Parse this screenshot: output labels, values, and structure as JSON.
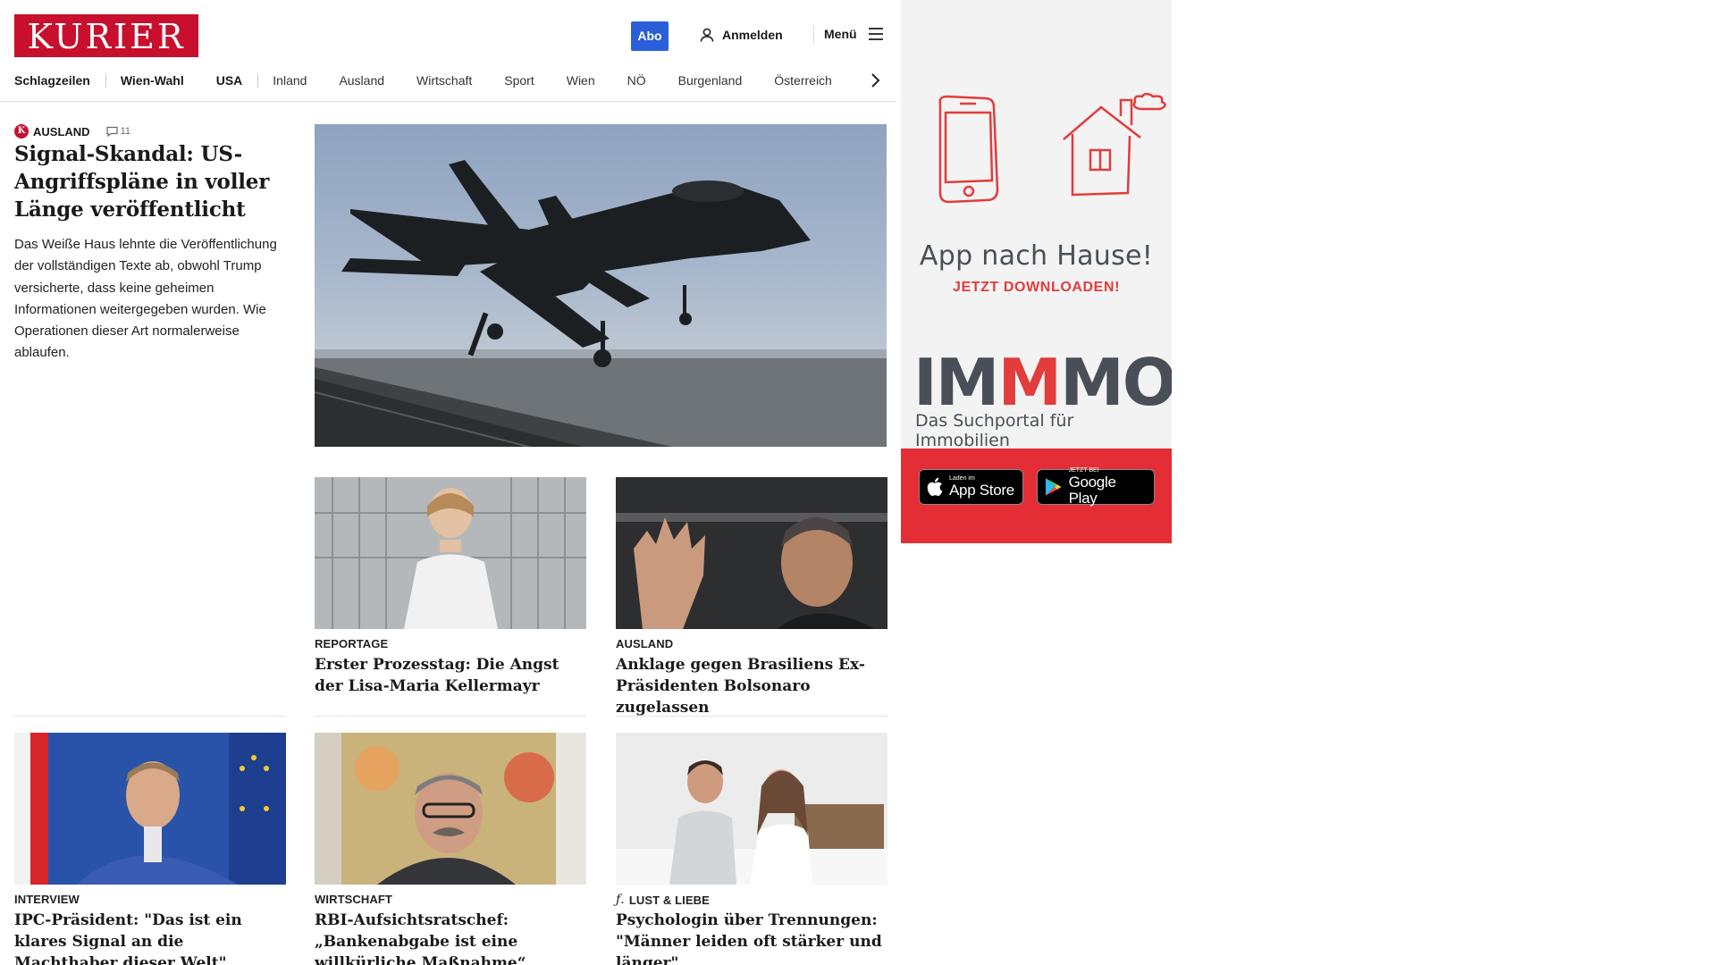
{
  "header": {
    "logo": "KURIER",
    "abo_label": "Abo",
    "login_label": "Anmelden",
    "menu_label": "Menü"
  },
  "nav": [
    {
      "label": "Schlagzeilen"
    },
    {
      "label": "Wien-Wahl"
    },
    {
      "label": "USA"
    },
    {
      "label": "Inland"
    },
    {
      "label": "Ausland"
    },
    {
      "label": "Wirtschaft"
    },
    {
      "label": "Sport"
    },
    {
      "label": "Wien"
    },
    {
      "label": "NÖ"
    },
    {
      "label": "Burgenland"
    },
    {
      "label": "Österreich"
    }
  ],
  "lead": {
    "badge": "K",
    "category": "AUSLAND",
    "comments": "11",
    "title": "Signal-Skandal: US-Angriffspläne in voller Länge veröffentlicht",
    "teaser": "Das Weiße Haus lehnte die Veröffentlichung der vollständigen Texte ab, obwohl Trump versicherte, dass keine geheimen Informationen weitergegeben wurden. Wie Operationen dieser Art normalerweise ablaufen."
  },
  "cards": [
    {
      "category": "REPORTAGE",
      "title": "Erster Prozesstag: Die Angst der Lisa-Maria Kellermayr"
    },
    {
      "category": "AUSLAND",
      "title": "Anklage gegen Brasiliens Ex-Präsidenten Bolsonaro zugelassen"
    },
    {
      "category": "INTERVIEW",
      "title": "IPC-Präsident: \"Das ist ein klares Signal an die Machthaber dieser Welt\""
    },
    {
      "category": "WIRTSCHAFT",
      "title": "RBI-Aufsichtsratschef: „Bankenabgabe ist eine willkürliche Maßnahme“"
    },
    {
      "category": "LUST & LIEBE",
      "title": "Psychologin über Trennungen: \"Männer leiden oft stärker und länger\""
    }
  ],
  "ad": {
    "title": "App nach Hause!",
    "subtitle": "JETZT DOWNLOADEN!",
    "brand_a": "IM",
    "brand_b": "M",
    "brand_c": "MO",
    "brand_sub": "Das Suchportal für Immobilien",
    "appstore_small": "Laden im",
    "appstore_big": "App Store",
    "googleplay_small": "JETZT BEI",
    "googleplay_big": "Google Play"
  },
  "colors": {
    "brand_red": "#c8102e",
    "abo_blue": "#2b5fd9",
    "ad_red": "#e42d35",
    "ad_gray": "#4a4f57"
  }
}
